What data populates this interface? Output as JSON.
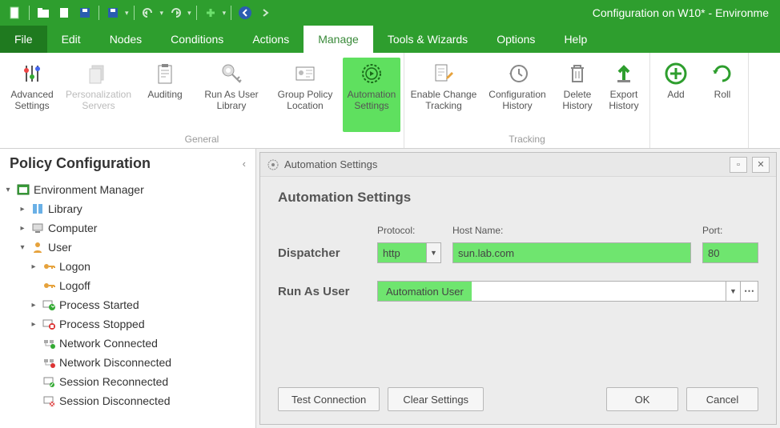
{
  "window_title": "Configuration on W10* - Environme",
  "menus": {
    "file": "File",
    "edit": "Edit",
    "nodes": "Nodes",
    "conditions": "Conditions",
    "actions": "Actions",
    "manage": "Manage",
    "tools": "Tools & Wizards",
    "options": "Options",
    "help": "Help"
  },
  "ribbon": {
    "groups": {
      "general": "General",
      "tracking": "Tracking"
    },
    "advanced": "Advanced\nSettings",
    "personalization": "Personalization\nServers",
    "auditing": "Auditing",
    "runas": "Run As User\nLibrary",
    "gpo": "Group Policy\nLocation",
    "autoset": "Automation\nSettings",
    "enablechange": "Enable Change\nTracking",
    "confighist": "Configuration\nHistory",
    "delhist": "Delete\nHistory",
    "exporthist": "Export\nHistory",
    "add": "Add",
    "roll": "Roll"
  },
  "sidebar": {
    "title": "Policy Configuration",
    "root": "Environment Manager",
    "library": "Library",
    "computer": "Computer",
    "user": "User",
    "logon": "Logon",
    "logoff": "Logoff",
    "pstart": "Process Started",
    "pstop": "Process Stopped",
    "netcon": "Network Connected",
    "netdis": "Network Disconnected",
    "sesrec": "Session Reconnected",
    "sesdis": "Session Disconnected"
  },
  "dialog": {
    "title": "Automation Settings",
    "heading": "Automation Settings",
    "protocol_lbl": "Protocol:",
    "hostname_lbl": "Host Name:",
    "port_lbl": "Port:",
    "dispatcher_lbl": "Dispatcher",
    "protocol_val": "http",
    "hostname_val": "sun.lab.com",
    "port_val": "80",
    "runas_lbl": "Run As User",
    "runas_val": "Automation User",
    "test_btn": "Test Connection",
    "clear_btn": "Clear Settings",
    "ok_btn": "OK",
    "cancel_btn": "Cancel"
  }
}
